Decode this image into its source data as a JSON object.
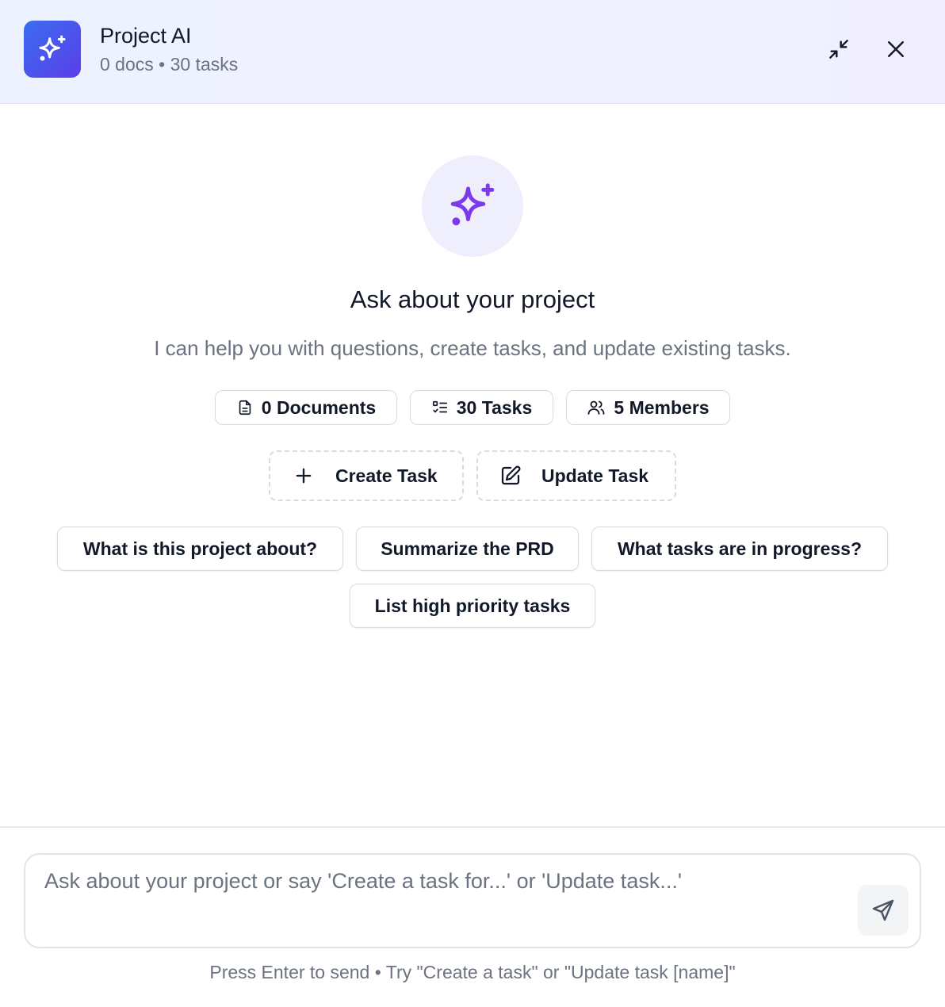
{
  "header": {
    "title": "Project AI",
    "subtitle": "0 docs • 30 tasks",
    "logo_icon": "sparkles-icon",
    "minimize_icon": "minimize-arrows-icon",
    "close_icon": "close-icon"
  },
  "hero": {
    "icon": "sparkles-icon",
    "title": "Ask about your project",
    "description": "I can help you with questions, create tasks, and update existing tasks."
  },
  "stats": [
    {
      "icon": "document-icon",
      "label": "0 Documents"
    },
    {
      "icon": "task-list-icon",
      "label": "30 Tasks"
    },
    {
      "icon": "users-icon",
      "label": "5 Members"
    }
  ],
  "actions": [
    {
      "icon": "plus-icon",
      "label": "Create Task"
    },
    {
      "icon": "edit-icon",
      "label": "Update Task"
    }
  ],
  "suggestions": [
    "What is this project about?",
    "Summarize the PRD",
    "What tasks are in progress?",
    "List high priority tasks"
  ],
  "composer": {
    "placeholder": "Ask about your project or say 'Create a task for...' or 'Update task...'",
    "value": "",
    "send_icon": "send-icon",
    "hint": "Press Enter to send • Try \"Create a task\" or \"Update task [name]\""
  },
  "colors": {
    "accent": "#7c3aed",
    "logo_gradient_start": "#3b6cf0",
    "logo_gradient_end": "#5b3ee8",
    "header_bg": "#eef2ff"
  }
}
